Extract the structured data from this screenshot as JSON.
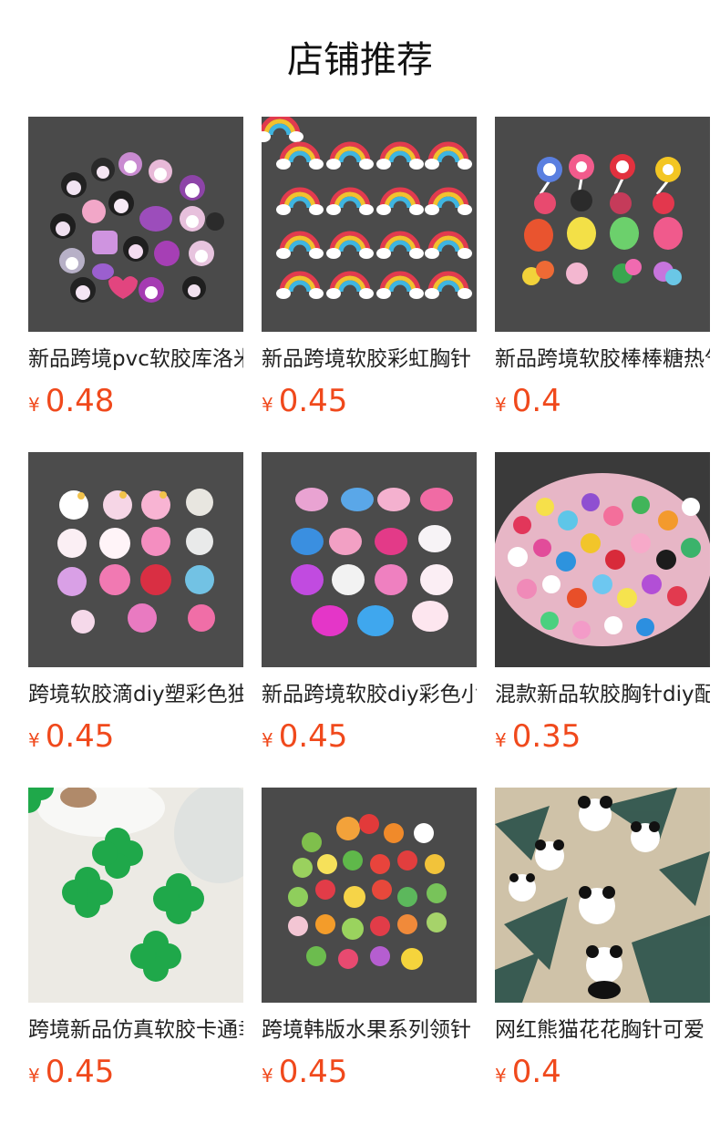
{
  "header": {
    "title": "店铺推荐"
  },
  "products": [
    {
      "name": "新品跨境pvc软胶库洛米胸针",
      "currency": "¥",
      "price": "0.48",
      "image": "kuromi-charms-photo",
      "bg": "#4a4a4a"
    },
    {
      "name": "新品跨境软胶彩虹胸针",
      "currency": "¥",
      "price": "0.45",
      "image": "rainbow-charms-photo",
      "bg": "#4b4b4b"
    },
    {
      "name": "新品跨境软胶棒棒糖热气球胸针",
      "currency": "¥",
      "price": "0.4",
      "image": "lollipop-balloon-charms-photo",
      "bg": "#4a4a4a"
    },
    {
      "name": "跨境软胶滴diy塑彩色独角兽",
      "currency": "¥",
      "price": "0.45",
      "image": "unicorn-head-charms-photo",
      "bg": "#4c4c4c"
    },
    {
      "name": "新品跨境软胶diy彩色小马",
      "currency": "¥",
      "price": "0.45",
      "image": "pony-charms-photo",
      "bg": "#4b4b4b"
    },
    {
      "name": "混款新品软胶胸针diy配件",
      "currency": "¥",
      "price": "0.35",
      "image": "mixed-charms-pile-photo",
      "bg": "#3a3a3a"
    },
    {
      "name": "跨境新品仿真软胶卡通幸运草",
      "currency": "¥",
      "price": "0.45",
      "image": "clover-charms-photo",
      "bg": "#eceae4"
    },
    {
      "name": "跨境韩版水果系列领针",
      "currency": "¥",
      "price": "0.45",
      "image": "fruit-charms-photo",
      "bg": "#4a4a4a"
    },
    {
      "name": "网红熊猫花花胸针可爱",
      "currency": "¥",
      "price": "0.4",
      "image": "panda-charms-photo",
      "bg": "#cfc2a8"
    }
  ]
}
